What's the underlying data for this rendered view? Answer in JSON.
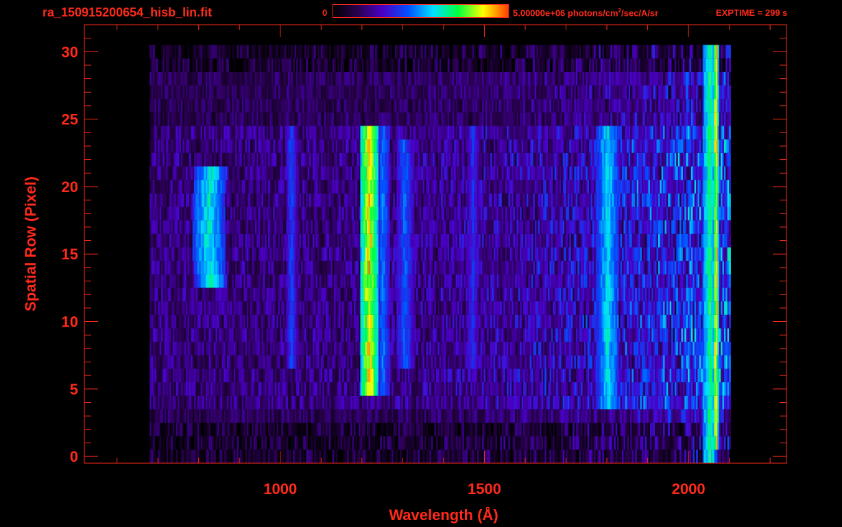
{
  "header": {
    "title": "ra_150915200654_hisb_lin.fit",
    "colorbar_min": "0",
    "colorbar_max_prefix": "5.00000e+06 photons/cm",
    "colorbar_max_sup": "2",
    "colorbar_max_suffix": "/sec/A/sr",
    "exptime": "EXPTIME = 299 s"
  },
  "colors": {
    "axis": "#ff2a1a",
    "background": "#000000",
    "colormap": [
      "#000000",
      "#2a0050",
      "#4a00c8",
      "#0050ff",
      "#00e0ff",
      "#00ff40",
      "#ffff00",
      "#ff4000"
    ]
  },
  "chart_data": {
    "type": "heatmap",
    "title": "ra_150915200654_hisb_lin.fit",
    "xlabel": "Wavelength (Å)",
    "ylabel": "Spatial Row (Pixel)",
    "xlim": [
      520,
      2240
    ],
    "ylim": [
      -0.5,
      32
    ],
    "x_ticks": [
      1000,
      1500,
      2000
    ],
    "x_tick_labels": [
      "1000",
      "1500",
      "2000"
    ],
    "y_ticks": [
      0,
      5,
      10,
      15,
      20,
      25,
      30
    ],
    "y_tick_labels": [
      "0",
      "5",
      "10",
      "15",
      "20",
      "25",
      "30"
    ],
    "colorbar": {
      "min": 0,
      "max": 5000000,
      "unit": "photons/cm2/sec/A/sr"
    },
    "data_extent": {
      "x": [
        680,
        2100
      ],
      "rows": [
        0,
        30
      ]
    },
    "features": [
      {
        "center": 840,
        "width": 40,
        "rows": [
          13,
          21
        ],
        "intensity": 0.62,
        "note": "curved"
      },
      {
        "center": 1025,
        "width": 14,
        "rows": [
          7,
          24
        ],
        "intensity": 0.42
      },
      {
        "center": 1216,
        "width": 24,
        "rows": [
          5,
          24
        ],
        "intensity": 0.9
      },
      {
        "center": 1250,
        "width": 18,
        "rows": [
          5,
          24
        ],
        "intensity": 0.48
      },
      {
        "center": 1303,
        "width": 22,
        "rows": [
          7,
          23
        ],
        "intensity": 0.45
      },
      {
        "center": 1470,
        "width": 14,
        "rows": [
          7,
          24
        ],
        "intensity": 0.38
      },
      {
        "center": 1800,
        "width": 28,
        "rows": [
          4,
          24
        ],
        "intensity": 0.6
      },
      {
        "center": 2050,
        "width": 18,
        "rows": [
          0,
          30
        ],
        "intensity": 0.7
      },
      {
        "center": 2065,
        "width": 6,
        "rows": [
          1,
          30
        ],
        "intensity": 0.95
      }
    ]
  }
}
